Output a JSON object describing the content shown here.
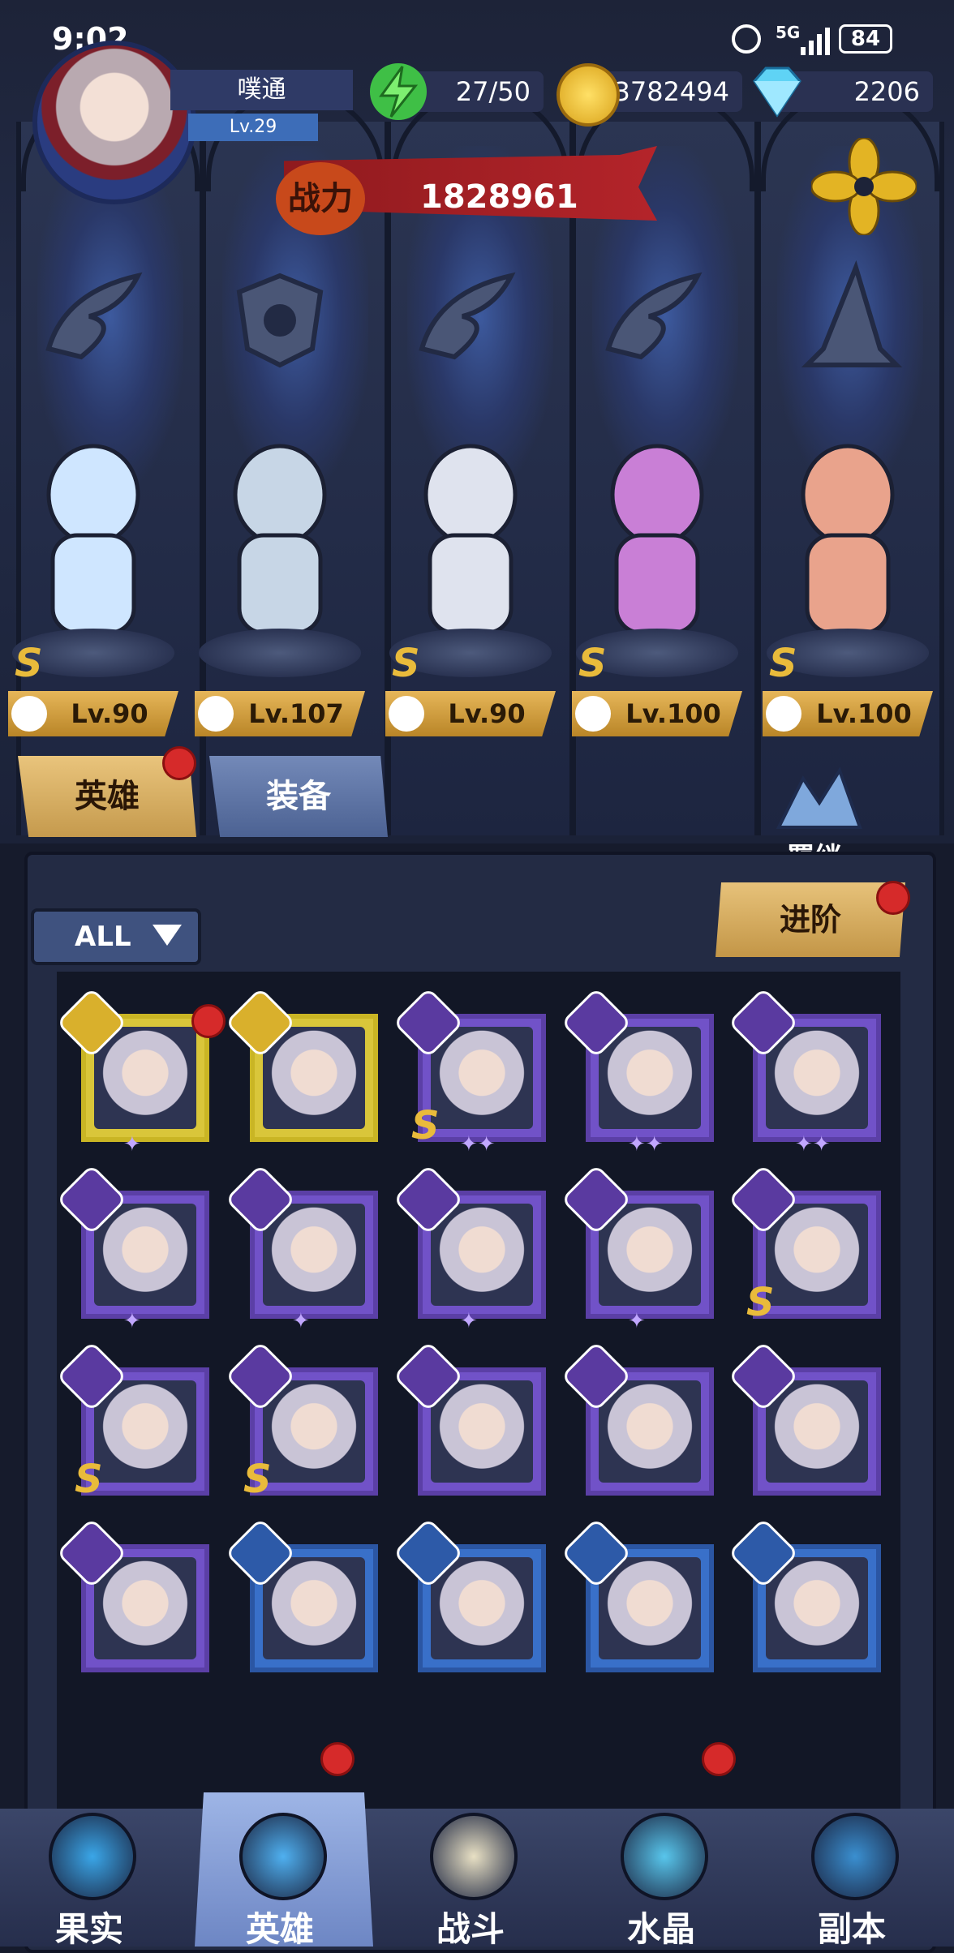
{
  "status_bar": {
    "time": "9:02",
    "network": "5G",
    "battery": "84"
  },
  "player": {
    "name": "噗通",
    "level": "Lv.29"
  },
  "resources": {
    "stamina": "27/50",
    "gold": "3782494",
    "diamonds": "2206"
  },
  "power": {
    "label": "战力",
    "value": "1828961"
  },
  "heroes": [
    {
      "level": "Lv.90",
      "rank": "S",
      "class_icon": "wing-icon",
      "color": "#cfe6ff"
    },
    {
      "level": "Lv.107",
      "rank": "",
      "class_icon": "beast-claw-icon",
      "color": "#c7d6e6"
    },
    {
      "level": "Lv.90",
      "rank": "S",
      "class_icon": "wing-icon",
      "color": "#dfe3ee"
    },
    {
      "level": "Lv.100",
      "rank": "S",
      "class_icon": "wing-icon",
      "color": "#c97fd6"
    },
    {
      "level": "Lv.100",
      "rank": "S",
      "class_icon": "wizard-hat-icon",
      "color": "#e9a38c"
    }
  ],
  "tabs": {
    "heroes": "英雄",
    "equipment": "装备"
  },
  "bond": {
    "label": "羁绊"
  },
  "filter": {
    "label": "ALL"
  },
  "advance": {
    "label": "进阶"
  },
  "cards": [
    {
      "rarity": "gold",
      "class": "wrench-icon",
      "s": false,
      "stars": "✦",
      "dot": true
    },
    {
      "rarity": "gold",
      "class": "wizard-hat-icon",
      "s": false,
      "stars": "",
      "dot": false
    },
    {
      "rarity": "purple",
      "class": "wrench-icon",
      "s": true,
      "stars": "✦✦",
      "dot": false
    },
    {
      "rarity": "purple",
      "class": "wizard-hat-icon",
      "s": false,
      "stars": "✦✦",
      "dot": false
    },
    {
      "rarity": "purple",
      "class": "wing-icon",
      "s": false,
      "stars": "✦✦",
      "dot": false
    },
    {
      "rarity": "purple",
      "class": "wizard-hat-icon",
      "s": false,
      "stars": "✦",
      "dot": false
    },
    {
      "rarity": "purple",
      "class": "wizard-hat-icon",
      "s": false,
      "stars": "✦",
      "dot": false
    },
    {
      "rarity": "purple",
      "class": "wrench-icon",
      "s": false,
      "stars": "✦",
      "dot": false
    },
    {
      "rarity": "purple",
      "class": "beast-claw-icon",
      "s": false,
      "stars": "✦",
      "dot": false
    },
    {
      "rarity": "purple",
      "class": "wing-icon",
      "s": true,
      "stars": "",
      "dot": false
    },
    {
      "rarity": "purple",
      "class": "wing-icon",
      "s": true,
      "stars": "",
      "dot": false
    },
    {
      "rarity": "purple",
      "class": "wing-icon",
      "s": true,
      "stars": "",
      "dot": false
    },
    {
      "rarity": "purple",
      "class": "wizard-hat-icon",
      "s": false,
      "stars": "",
      "dot": false
    },
    {
      "rarity": "purple",
      "class": "wing-icon",
      "s": false,
      "stars": "",
      "dot": false
    },
    {
      "rarity": "purple",
      "class": "wing-icon",
      "s": false,
      "stars": "",
      "dot": false
    },
    {
      "rarity": "purple",
      "class": "beast-claw-icon",
      "s": false,
      "stars": "",
      "dot": false
    },
    {
      "rarity": "blue",
      "class": "wing-icon",
      "s": false,
      "stars": "",
      "dot": false
    },
    {
      "rarity": "blue",
      "class": "wing-icon",
      "s": false,
      "stars": "",
      "dot": false
    },
    {
      "rarity": "blue",
      "class": "wing-icon",
      "s": false,
      "stars": "",
      "dot": false
    },
    {
      "rarity": "blue",
      "class": "wing-icon",
      "s": false,
      "stars": "",
      "dot": false
    }
  ],
  "nav": [
    {
      "label": "果实",
      "icon": "fruit-icon",
      "selected": false,
      "dot": false
    },
    {
      "label": "英雄",
      "icon": "hero-icon",
      "selected": true,
      "dot": true
    },
    {
      "label": "战斗",
      "icon": "battle-icon",
      "selected": false,
      "dot": false
    },
    {
      "label": "水晶",
      "icon": "crystal-icon",
      "selected": false,
      "dot": true
    },
    {
      "label": "副本",
      "icon": "dungeon-icon",
      "selected": false,
      "dot": false
    }
  ]
}
